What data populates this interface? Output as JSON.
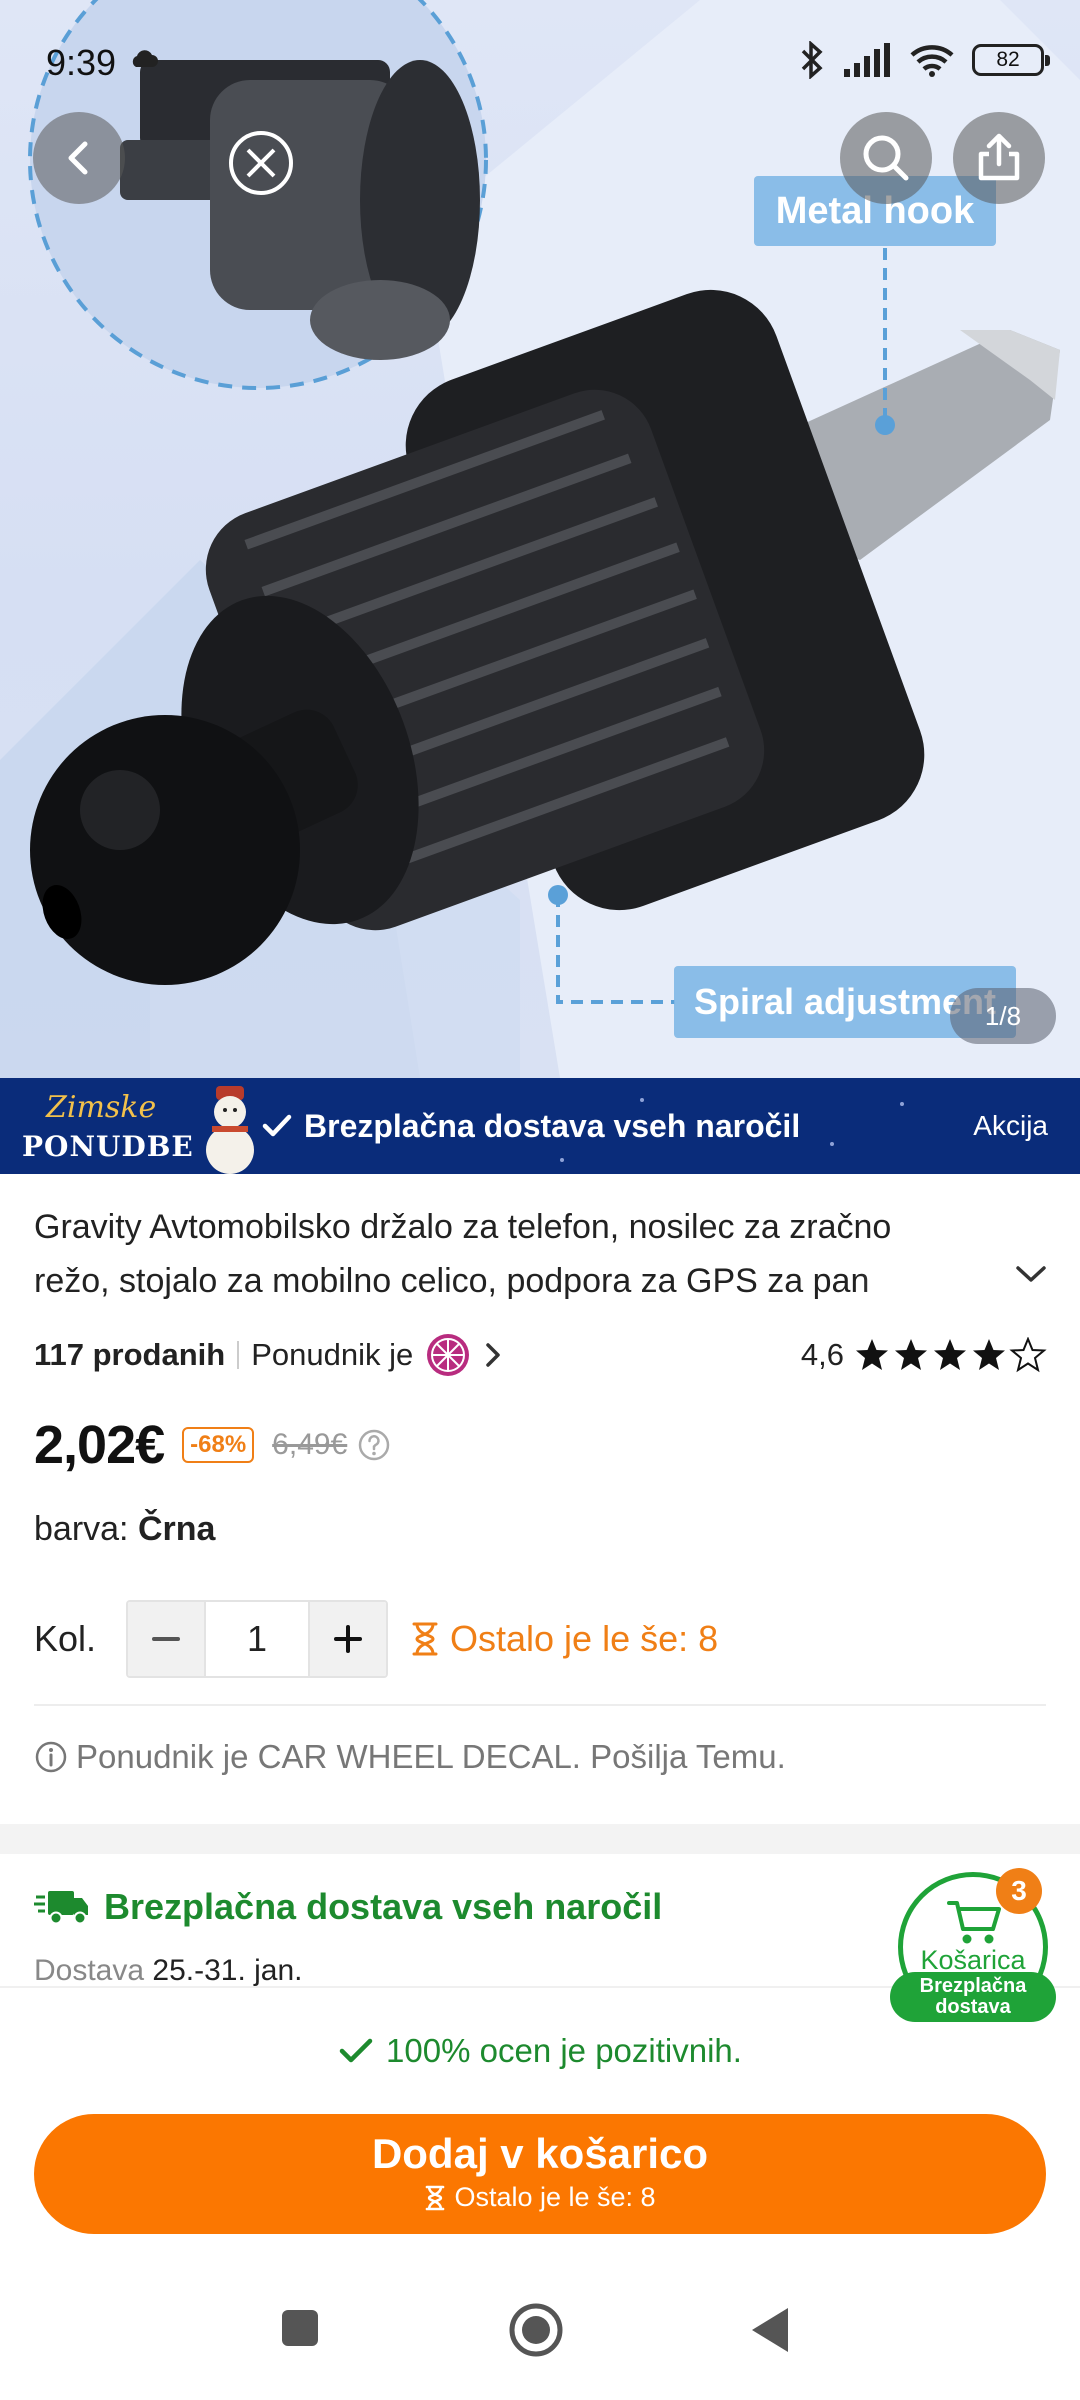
{
  "status_bar": {
    "time": "9:39",
    "battery": "82",
    "icons": [
      "bluetooth-icon",
      "signal-icon",
      "wifi-icon",
      "battery-icon"
    ]
  },
  "hero": {
    "image_counter": "1/8",
    "callouts": {
      "metal_hook": "Metal hook",
      "spiral_adjustment": "Spiral adjustment"
    }
  },
  "promo": {
    "logo_line1": "Zimske",
    "logo_line2": "PONUDBE",
    "text": "Brezplačna dostava vseh naročil",
    "action": "Akcija"
  },
  "product": {
    "title": "Gravity Avtomobilsko držalo za telefon, nosilec za zračno režo, stojalo za mobilno celico, podpora za GPS za pan",
    "sold": "117 prodanih",
    "seller_label": "Ponudnik je",
    "rating": "4,6",
    "rating_value": 4.6,
    "price": "2,02€",
    "discount": "-68%",
    "old_price": "6,49€",
    "color_label": "barva:",
    "color_value": "Črna",
    "qty_label": "Kol.",
    "qty_value": "1",
    "stock_text": "Ostalo je le še: 8",
    "seller_info": "Ponudnik je CAR WHEEL DECAL. Pošilja Temu."
  },
  "shipping": {
    "title": "Brezplačna dostava vseh naročil",
    "delivery_label": "Dostava",
    "delivery_dates": "25.-31. jan."
  },
  "cart_fab": {
    "label": "Košarica",
    "count": "3",
    "shipping_line1": "Brezplačna",
    "shipping_line2": "dostava"
  },
  "bottom": {
    "positive_reviews": "100% ocen je pozitivnih.",
    "add_to_cart": "Dodaj v košarico",
    "stock_sub": "Ostalo je le še: 8"
  },
  "colors": {
    "accent_orange": "#fb7701",
    "green": "#1d8a2e",
    "promo_blue": "#0a2c7a"
  }
}
